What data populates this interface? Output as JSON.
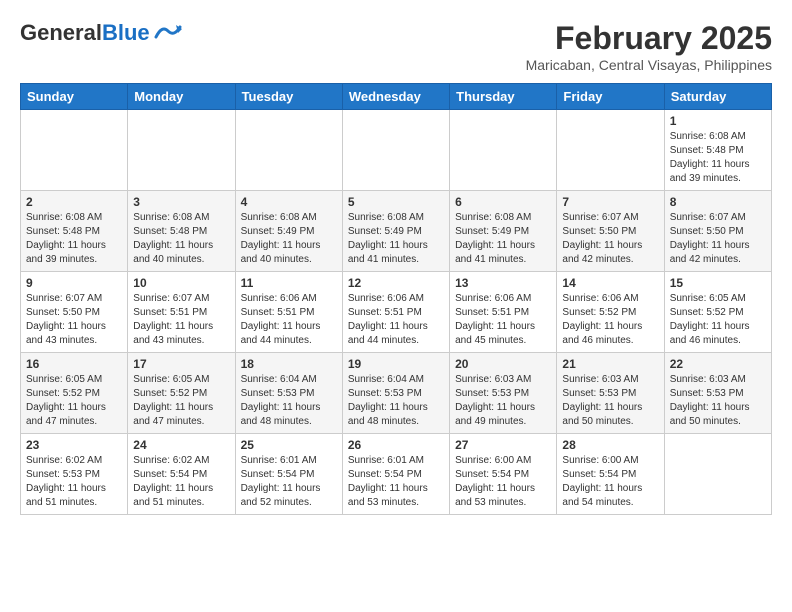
{
  "header": {
    "logo_general": "General",
    "logo_blue": "Blue",
    "title": "February 2025",
    "subtitle": "Maricaban, Central Visayas, Philippines"
  },
  "weekdays": [
    "Sunday",
    "Monday",
    "Tuesday",
    "Wednesday",
    "Thursday",
    "Friday",
    "Saturday"
  ],
  "weeks": [
    [
      {
        "day": "",
        "info": ""
      },
      {
        "day": "",
        "info": ""
      },
      {
        "day": "",
        "info": ""
      },
      {
        "day": "",
        "info": ""
      },
      {
        "day": "",
        "info": ""
      },
      {
        "day": "",
        "info": ""
      },
      {
        "day": "1",
        "info": "Sunrise: 6:08 AM\nSunset: 5:48 PM\nDaylight: 11 hours and 39 minutes."
      }
    ],
    [
      {
        "day": "2",
        "info": "Sunrise: 6:08 AM\nSunset: 5:48 PM\nDaylight: 11 hours and 39 minutes."
      },
      {
        "day": "3",
        "info": "Sunrise: 6:08 AM\nSunset: 5:48 PM\nDaylight: 11 hours and 40 minutes."
      },
      {
        "day": "4",
        "info": "Sunrise: 6:08 AM\nSunset: 5:49 PM\nDaylight: 11 hours and 40 minutes."
      },
      {
        "day": "5",
        "info": "Sunrise: 6:08 AM\nSunset: 5:49 PM\nDaylight: 11 hours and 41 minutes."
      },
      {
        "day": "6",
        "info": "Sunrise: 6:08 AM\nSunset: 5:49 PM\nDaylight: 11 hours and 41 minutes."
      },
      {
        "day": "7",
        "info": "Sunrise: 6:07 AM\nSunset: 5:50 PM\nDaylight: 11 hours and 42 minutes."
      },
      {
        "day": "8",
        "info": "Sunrise: 6:07 AM\nSunset: 5:50 PM\nDaylight: 11 hours and 42 minutes."
      }
    ],
    [
      {
        "day": "9",
        "info": "Sunrise: 6:07 AM\nSunset: 5:50 PM\nDaylight: 11 hours and 43 minutes."
      },
      {
        "day": "10",
        "info": "Sunrise: 6:07 AM\nSunset: 5:51 PM\nDaylight: 11 hours and 43 minutes."
      },
      {
        "day": "11",
        "info": "Sunrise: 6:06 AM\nSunset: 5:51 PM\nDaylight: 11 hours and 44 minutes."
      },
      {
        "day": "12",
        "info": "Sunrise: 6:06 AM\nSunset: 5:51 PM\nDaylight: 11 hours and 44 minutes."
      },
      {
        "day": "13",
        "info": "Sunrise: 6:06 AM\nSunset: 5:51 PM\nDaylight: 11 hours and 45 minutes."
      },
      {
        "day": "14",
        "info": "Sunrise: 6:06 AM\nSunset: 5:52 PM\nDaylight: 11 hours and 46 minutes."
      },
      {
        "day": "15",
        "info": "Sunrise: 6:05 AM\nSunset: 5:52 PM\nDaylight: 11 hours and 46 minutes."
      }
    ],
    [
      {
        "day": "16",
        "info": "Sunrise: 6:05 AM\nSunset: 5:52 PM\nDaylight: 11 hours and 47 minutes."
      },
      {
        "day": "17",
        "info": "Sunrise: 6:05 AM\nSunset: 5:52 PM\nDaylight: 11 hours and 47 minutes."
      },
      {
        "day": "18",
        "info": "Sunrise: 6:04 AM\nSunset: 5:53 PM\nDaylight: 11 hours and 48 minutes."
      },
      {
        "day": "19",
        "info": "Sunrise: 6:04 AM\nSunset: 5:53 PM\nDaylight: 11 hours and 48 minutes."
      },
      {
        "day": "20",
        "info": "Sunrise: 6:03 AM\nSunset: 5:53 PM\nDaylight: 11 hours and 49 minutes."
      },
      {
        "day": "21",
        "info": "Sunrise: 6:03 AM\nSunset: 5:53 PM\nDaylight: 11 hours and 50 minutes."
      },
      {
        "day": "22",
        "info": "Sunrise: 6:03 AM\nSunset: 5:53 PM\nDaylight: 11 hours and 50 minutes."
      }
    ],
    [
      {
        "day": "23",
        "info": "Sunrise: 6:02 AM\nSunset: 5:53 PM\nDaylight: 11 hours and 51 minutes."
      },
      {
        "day": "24",
        "info": "Sunrise: 6:02 AM\nSunset: 5:54 PM\nDaylight: 11 hours and 51 minutes."
      },
      {
        "day": "25",
        "info": "Sunrise: 6:01 AM\nSunset: 5:54 PM\nDaylight: 11 hours and 52 minutes."
      },
      {
        "day": "26",
        "info": "Sunrise: 6:01 AM\nSunset: 5:54 PM\nDaylight: 11 hours and 53 minutes."
      },
      {
        "day": "27",
        "info": "Sunrise: 6:00 AM\nSunset: 5:54 PM\nDaylight: 11 hours and 53 minutes."
      },
      {
        "day": "28",
        "info": "Sunrise: 6:00 AM\nSunset: 5:54 PM\nDaylight: 11 hours and 54 minutes."
      },
      {
        "day": "",
        "info": ""
      }
    ]
  ]
}
